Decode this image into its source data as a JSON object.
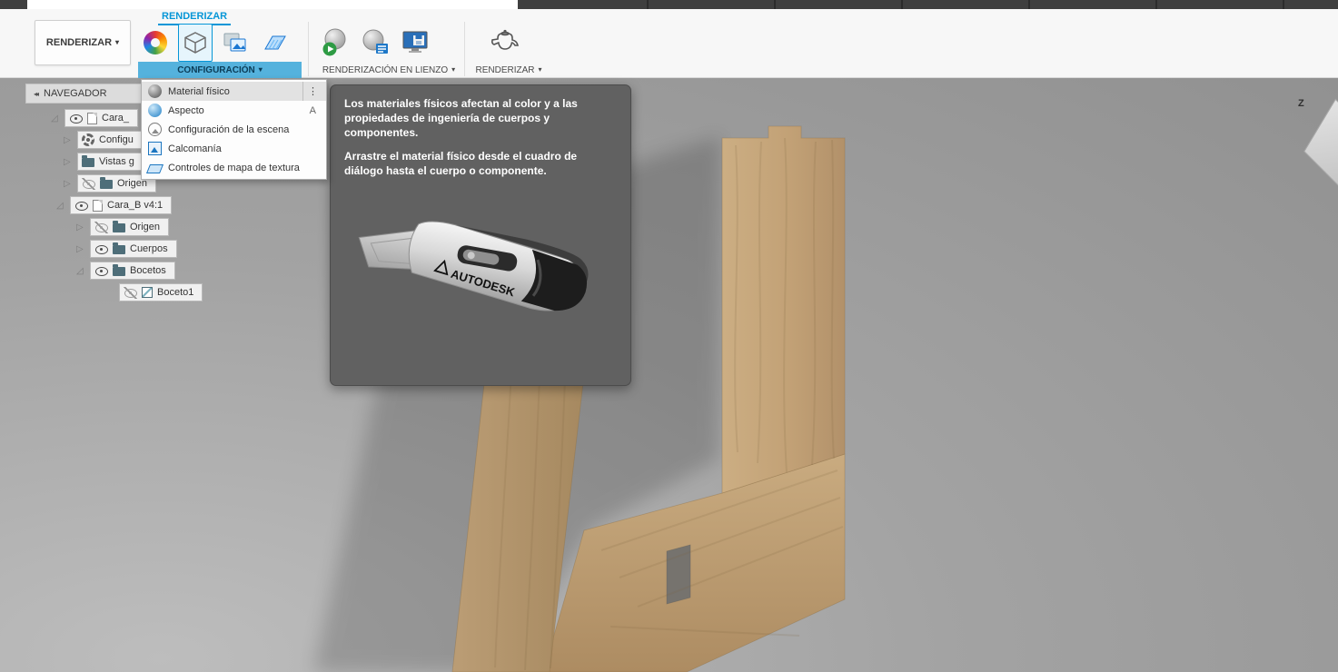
{
  "colors": {
    "accent_blue": "#0696d7",
    "group_label_active_bg": "#55b2dd",
    "canvas_gray": "#9c9c9c",
    "tooltip_bg": "#616161",
    "wood_light": "#cbb08a",
    "wood_dark": "#a5885f",
    "menu_highlight": "#e2e2e2"
  },
  "glyphs": {
    "caret_down": "▾",
    "collapse_left": "◂◂",
    "kebab": "⋮",
    "twisty_collapsed": "▷",
    "twisty_expanded": "◿"
  },
  "toolbar": {
    "render_dropdown_label": "RENDERIZAR",
    "workspace_tab": "RENDERIZAR",
    "groups": [
      {
        "label": "CONFIGURACIÓN",
        "icons": [
          "color-wheel-icon",
          "scene-settings-icon",
          "decal-icon",
          "texture-map-controls-icon"
        ]
      },
      {
        "label": "RENDERIZACIÓN EN LIENZO",
        "icons": [
          "in-canvas-render-icon",
          "in-canvas-render-settings-icon",
          "capture-render-icon"
        ]
      },
      {
        "label": "RENDERIZAR",
        "icons": [
          "render-teapot-icon"
        ]
      }
    ]
  },
  "menu": {
    "items": [
      {
        "label": "Material físico",
        "icon": "material-sphere-icon",
        "trailing": "⋮",
        "highlighted": true
      },
      {
        "label": "Aspecto",
        "icon": "appearance-sphere-icon",
        "shortcut": "A"
      },
      {
        "label": "Configuración de la escena",
        "icon": "scene-settings-icon"
      },
      {
        "label": "Calcomanía",
        "icon": "decal-icon"
      },
      {
        "label": "Controles de mapa de textura",
        "icon": "texture-map-icon"
      }
    ]
  },
  "tooltip": {
    "paragraph1": "Los materiales físicos afectan al color y a las propiedades de ingeniería de cuerpos y componentes.",
    "paragraph2": "Arrastre el material físico desde el cuadro de diálogo hasta el cuerpo o componente.",
    "image_text": "AUTODESK"
  },
  "navigator": {
    "header": "NAVEGADOR",
    "rows": [
      {
        "label": "Cara_",
        "icon": "document-icon",
        "eye": "visible",
        "twisty": "expanded"
      },
      {
        "label": "Configu",
        "icon": "gear-icon",
        "eye": "none",
        "twisty": "collapsed"
      },
      {
        "label": "Vistas g",
        "icon": "folder-icon",
        "eye": "none",
        "twisty": "collapsed"
      },
      {
        "label": "Origen",
        "icon": "folder-icon",
        "eye": "hidden",
        "twisty": "collapsed"
      },
      {
        "label": "Cara_B v4:1",
        "icon": "document-icon",
        "eye": "visible",
        "twisty": "expanded"
      },
      {
        "label": "Origen",
        "icon": "folder-icon",
        "eye": "hidden",
        "twisty": "collapsed"
      },
      {
        "label": "Cuerpos",
        "icon": "folder-icon",
        "eye": "visible",
        "twisty": "collapsed"
      },
      {
        "label": "Bocetos",
        "icon": "folder-icon",
        "eye": "visible",
        "twisty": "expanded"
      },
      {
        "label": "Boceto1",
        "icon": "sketch-icon",
        "eye": "hidden",
        "twisty": "none"
      }
    ]
  },
  "viewcube": {
    "axis_label": "Z"
  }
}
